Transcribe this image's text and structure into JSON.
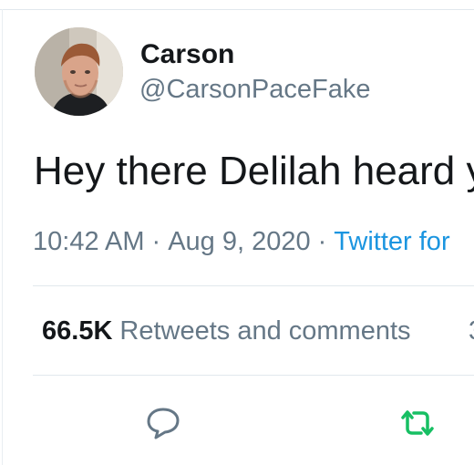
{
  "tweet": {
    "display_name": "Carson",
    "handle": "@CarsonPaceFake",
    "text": "Hey there Delilah heard y",
    "time": "10:42 AM",
    "separator": "·",
    "date": "Aug 9, 2020",
    "source": "Twitter for"
  },
  "stats": {
    "count": "66.5K",
    "label": "Retweets and comments"
  },
  "actions": {
    "reply_icon": "reply-icon",
    "retweet_icon": "retweet-icon"
  },
  "colors": {
    "primary_text": "#14171a",
    "secondary_text": "#657786",
    "link": "#1b95e0",
    "retweet_green": "#17bf63",
    "divider": "#e1e8ed"
  }
}
